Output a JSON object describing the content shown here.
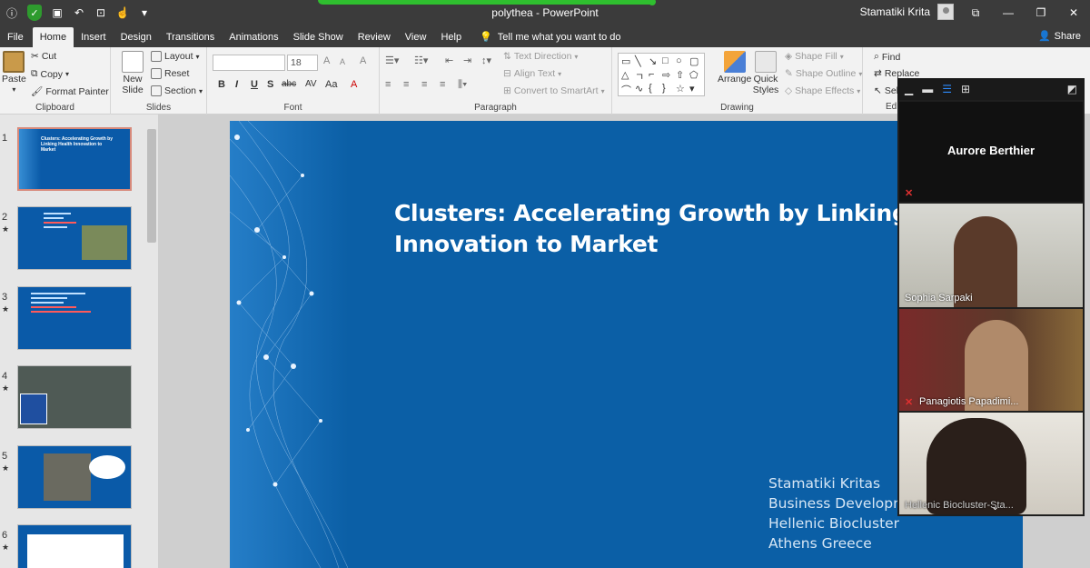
{
  "app": {
    "doc_title": "polythea  -  PowerPoint",
    "user_name": "Stamatiki Krita"
  },
  "tabs": [
    {
      "label": "File"
    },
    {
      "label": "Home"
    },
    {
      "label": "Insert"
    },
    {
      "label": "Design"
    },
    {
      "label": "Transitions"
    },
    {
      "label": "Animations"
    },
    {
      "label": "Slide Show"
    },
    {
      "label": "Review"
    },
    {
      "label": "View"
    },
    {
      "label": "Help"
    }
  ],
  "tell_me": "Tell me what you want to do",
  "share": "Share",
  "ribbon": {
    "clipboard": {
      "paste": "Paste",
      "cut": "Cut",
      "copy": "Copy",
      "format_painter": "Format Painter",
      "label": "Clipboard"
    },
    "slides": {
      "new_slide": "New Slide",
      "layout": "Layout",
      "reset": "Reset",
      "section": "Section",
      "label": "Slides"
    },
    "font": {
      "size": "18",
      "label": "Font"
    },
    "paragraph": {
      "text_direction": "Text Direction",
      "align_text": "Align Text",
      "smartart": "Convert to SmartArt",
      "label": "Paragraph"
    },
    "drawing": {
      "arrange": "Arrange",
      "quick_styles": "Quick Styles",
      "shape_fill": "Shape Fill",
      "shape_outline": "Shape Outline",
      "shape_effects": "Shape Effects",
      "label": "Drawing"
    },
    "editing": {
      "find": "Find",
      "replace": "Replace",
      "select": "Sel",
      "label": "Ed"
    }
  },
  "thumbnails": [
    {
      "num": "1",
      "star": "",
      "text": "Clusters: Accelerating Growth by Linking Health Innovation to Market"
    },
    {
      "num": "2",
      "star": "★",
      "text": ""
    },
    {
      "num": "3",
      "star": "★",
      "text": ""
    },
    {
      "num": "4",
      "star": "★",
      "text": ""
    },
    {
      "num": "5",
      "star": "★",
      "text": ""
    },
    {
      "num": "6",
      "star": "★",
      "text": ""
    }
  ],
  "slide": {
    "title": "Clusters: Accelerating Growth by Linking Healt\nInnovation to Market",
    "subtitle": [
      "Stamatiki Kritas",
      "Business Developm",
      "Hellenic Biocluster",
      "Athens Greece"
    ]
  },
  "video_panel": {
    "participants": [
      {
        "name": "Aurore Berthier"
      },
      {
        "name": "Sophia Sarpaki"
      },
      {
        "name": "Panagiotis Papadimi..."
      },
      {
        "name": "Hellenic Biocluster-Sta..."
      }
    ]
  }
}
